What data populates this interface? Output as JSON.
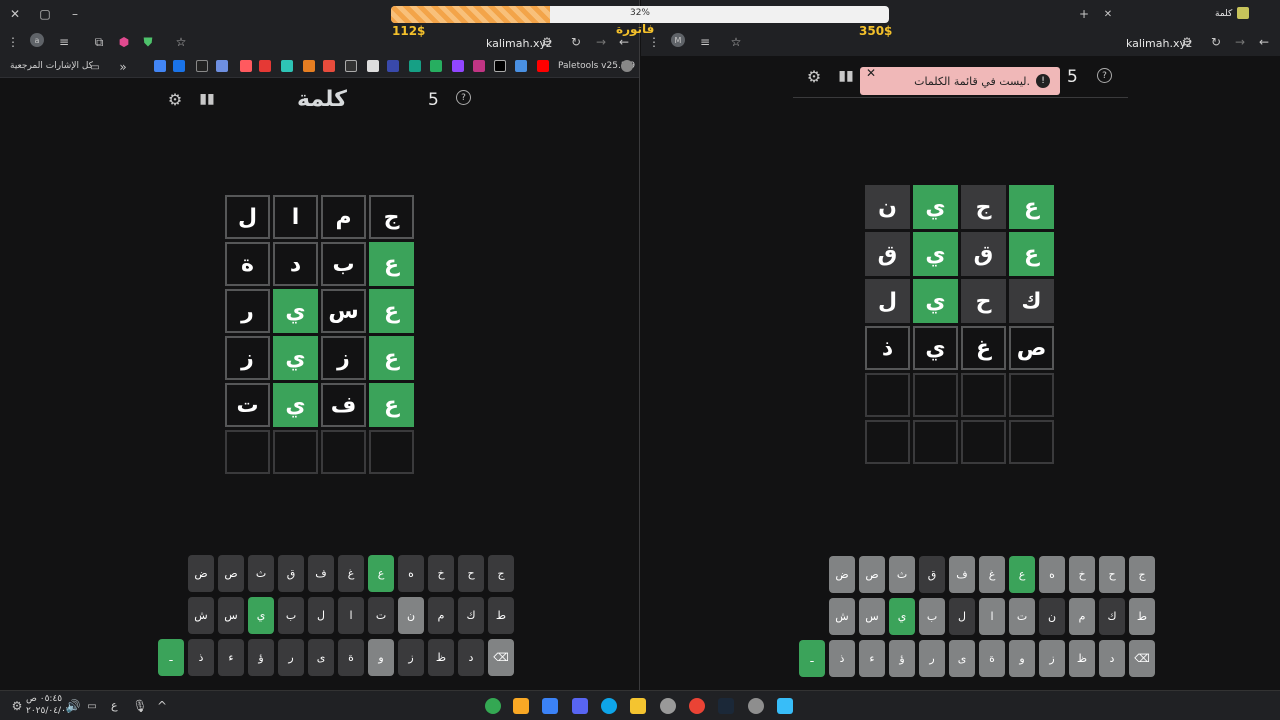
{
  "overlay": {
    "progress_percent": "32%",
    "progress_value": 0.32,
    "price_left": "112$",
    "price_right": "350$",
    "center_label": "فاتورة"
  },
  "left_window": {
    "omnibox_url": "kalimah.xyz",
    "bookmark_folder": "كل الإشارات المرجعية",
    "bookmark_last": "Paletools v25.1.9",
    "game_title": "كلمة",
    "letter_count": "5",
    "grid": [
      [
        {
          "l": "ل",
          "s": "f"
        },
        {
          "l": "ا",
          "s": "f"
        },
        {
          "l": "م",
          "s": "f"
        },
        {
          "l": "ج",
          "s": "f"
        }
      ],
      [
        {
          "l": "ة",
          "s": "f"
        },
        {
          "l": "د",
          "s": "f"
        },
        {
          "l": "ب",
          "s": "f"
        },
        {
          "l": "ع",
          "s": "g"
        }
      ],
      [
        {
          "l": "ر",
          "s": "f"
        },
        {
          "l": "ي",
          "s": "g"
        },
        {
          "l": "س",
          "s": "f"
        },
        {
          "l": "ع",
          "s": "g"
        }
      ],
      [
        {
          "l": "ز",
          "s": "f"
        },
        {
          "l": "ي",
          "s": "g"
        },
        {
          "l": "ز",
          "s": "f"
        },
        {
          "l": "ع",
          "s": "g"
        }
      ],
      [
        {
          "l": "ت",
          "s": "f"
        },
        {
          "l": "ي",
          "s": "g"
        },
        {
          "l": "ف",
          "s": "f"
        },
        {
          "l": "ع",
          "s": "g"
        }
      ],
      [
        {
          "l": "",
          "s": "e"
        },
        {
          "l": "",
          "s": "e"
        },
        {
          "l": "",
          "s": "e"
        },
        {
          "l": "",
          "s": "e"
        }
      ]
    ],
    "keyboard": [
      [
        {
          "k": "ج",
          "s": "d"
        },
        {
          "k": "ح",
          "s": "d"
        },
        {
          "k": "خ",
          "s": "d"
        },
        {
          "k": "ه",
          "s": "d"
        },
        {
          "k": "ع",
          "s": "g"
        },
        {
          "k": "غ",
          "s": "d"
        },
        {
          "k": "ف",
          "s": "d"
        },
        {
          "k": "ق",
          "s": "d"
        },
        {
          "k": "ث",
          "s": "d"
        },
        {
          "k": "ص",
          "s": "d"
        },
        {
          "k": "ض",
          "s": "d"
        }
      ],
      [
        {
          "k": "ط",
          "s": "d"
        },
        {
          "k": "ك",
          "s": "d"
        },
        {
          "k": "م",
          "s": "d"
        },
        {
          "k": "ن",
          "s": "n"
        },
        {
          "k": "ت",
          "s": "d"
        },
        {
          "k": "ا",
          "s": "d"
        },
        {
          "k": "ل",
          "s": "d"
        },
        {
          "k": "ب",
          "s": "d"
        },
        {
          "k": "ي",
          "s": "g"
        },
        {
          "k": "س",
          "s": "d"
        },
        {
          "k": "ش",
          "s": "d"
        }
      ],
      [
        {
          "k": "⌫",
          "s": "n"
        },
        {
          "k": "د",
          "s": "d"
        },
        {
          "k": "ظ",
          "s": "d"
        },
        {
          "k": "ز",
          "s": "d"
        },
        {
          "k": "و",
          "s": "n"
        },
        {
          "k": "ة",
          "s": "d"
        },
        {
          "k": "ى",
          "s": "d"
        },
        {
          "k": "ر",
          "s": "d"
        },
        {
          "k": "ؤ",
          "s": "d"
        },
        {
          "k": "ء",
          "s": "d"
        },
        {
          "k": "ذ",
          "s": "d"
        },
        {
          "k": "ـ",
          "s": "g"
        }
      ]
    ]
  },
  "right_window": {
    "tab_title": "كلمة",
    "omnibox_url": "kalimah.xyz",
    "letter_count": "5",
    "toast_text": "ليست في قائمة الكلمات.",
    "grid": [
      [
        {
          "l": "ن",
          "s": "d"
        },
        {
          "l": "ي",
          "s": "g"
        },
        {
          "l": "ج",
          "s": "d"
        },
        {
          "l": "ع",
          "s": "g"
        }
      ],
      [
        {
          "l": "ق",
          "s": "d"
        },
        {
          "l": "ي",
          "s": "g"
        },
        {
          "l": "ق",
          "s": "d"
        },
        {
          "l": "ع",
          "s": "g"
        }
      ],
      [
        {
          "l": "ل",
          "s": "d"
        },
        {
          "l": "ي",
          "s": "g"
        },
        {
          "l": "ح",
          "s": "d"
        },
        {
          "l": "ك",
          "s": "d"
        }
      ],
      [
        {
          "l": "ذ",
          "s": "f"
        },
        {
          "l": "ي",
          "s": "f"
        },
        {
          "l": "غ",
          "s": "f"
        },
        {
          "l": "ص",
          "s": "f"
        }
      ],
      [
        {
          "l": "",
          "s": "e"
        },
        {
          "l": "",
          "s": "e"
        },
        {
          "l": "",
          "s": "e"
        },
        {
          "l": "",
          "s": "e"
        }
      ],
      [
        {
          "l": "",
          "s": "e"
        },
        {
          "l": "",
          "s": "e"
        },
        {
          "l": "",
          "s": "e"
        },
        {
          "l": "",
          "s": "e"
        }
      ]
    ],
    "keyboard": [
      [
        {
          "k": "ج",
          "s": "n"
        },
        {
          "k": "ح",
          "s": "n"
        },
        {
          "k": "خ",
          "s": "n"
        },
        {
          "k": "ه",
          "s": "n"
        },
        {
          "k": "ع",
          "s": "g"
        },
        {
          "k": "غ",
          "s": "n"
        },
        {
          "k": "ف",
          "s": "n"
        },
        {
          "k": "ق",
          "s": "d"
        },
        {
          "k": "ث",
          "s": "n"
        },
        {
          "k": "ص",
          "s": "n"
        },
        {
          "k": "ض",
          "s": "n"
        }
      ],
      [
        {
          "k": "ط",
          "s": "n"
        },
        {
          "k": "ك",
          "s": "d"
        },
        {
          "k": "م",
          "s": "n"
        },
        {
          "k": "ن",
          "s": "d"
        },
        {
          "k": "ت",
          "s": "n"
        },
        {
          "k": "ا",
          "s": "n"
        },
        {
          "k": "ل",
          "s": "d"
        },
        {
          "k": "ب",
          "s": "n"
        },
        {
          "k": "ي",
          "s": "g"
        },
        {
          "k": "س",
          "s": "n"
        },
        {
          "k": "ش",
          "s": "n"
        }
      ],
      [
        {
          "k": "⌫",
          "s": "n"
        },
        {
          "k": "د",
          "s": "n"
        },
        {
          "k": "ظ",
          "s": "n"
        },
        {
          "k": "ز",
          "s": "n"
        },
        {
          "k": "و",
          "s": "n"
        },
        {
          "k": "ة",
          "s": "n"
        },
        {
          "k": "ى",
          "s": "n"
        },
        {
          "k": "ر",
          "s": "n"
        },
        {
          "k": "ؤ",
          "s": "n"
        },
        {
          "k": "ء",
          "s": "n"
        },
        {
          "k": "ذ",
          "s": "n"
        },
        {
          "k": "ـ",
          "s": "g"
        }
      ]
    ]
  },
  "taskbar": {
    "time": "٠٥:٤٥ ص",
    "date": "٢٠٢٥/٠٤/٠٧",
    "lang": "ع"
  }
}
